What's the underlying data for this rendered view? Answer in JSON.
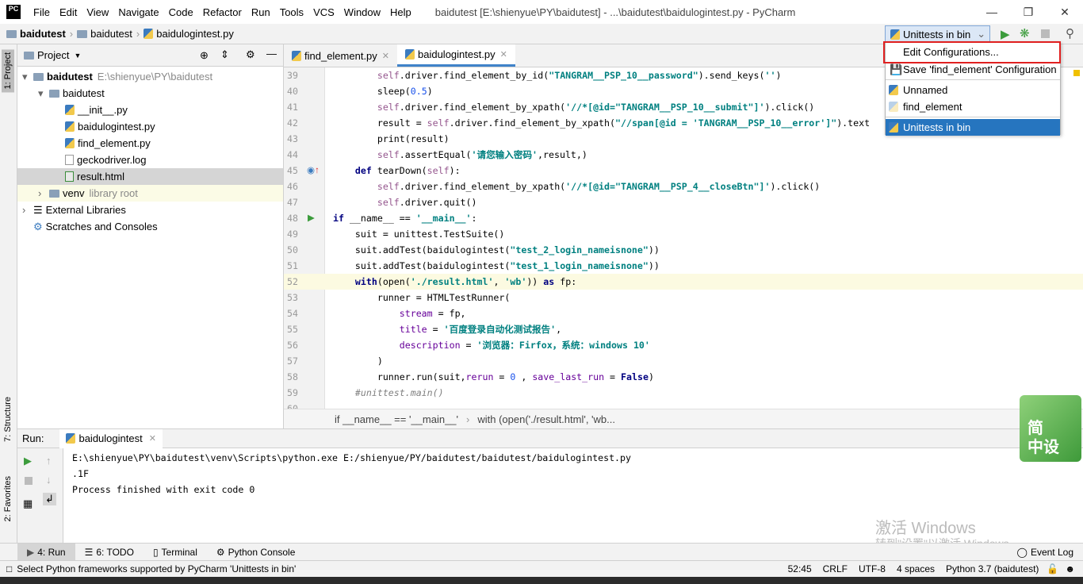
{
  "app": {
    "logo": "PC",
    "title": "baidutest [E:\\shienyue\\PY\\baidutest] - ...\\baidutest\\baidulogintest.py - PyCharm"
  },
  "menu": [
    "File",
    "Edit",
    "View",
    "Navigate",
    "Code",
    "Refactor",
    "Run",
    "Tools",
    "VCS",
    "Window",
    "Help"
  ],
  "breadcrumb": [
    "baidutest",
    "baidutest",
    "baidulogintest.py"
  ],
  "run_config": {
    "selected": "Unittests in bin",
    "menu": {
      "edit": "Edit Configurations...",
      "save": "Save 'find_element' Configuration",
      "items": [
        "Unnamed",
        "find_element"
      ],
      "current": "Unittests in bin"
    }
  },
  "left_stripe": {
    "project": "1: Project",
    "structure": "7: Structure",
    "favorites": "2: Favorites"
  },
  "project": {
    "header": "Project",
    "tree": [
      {
        "label": "baidutest",
        "extra": "E:\\shienyue\\PY\\baidutest",
        "type": "folder",
        "depth": 0,
        "bold": true
      },
      {
        "label": "baidutest",
        "type": "folder",
        "depth": 1
      },
      {
        "label": "__init__.py",
        "type": "py",
        "depth": 2
      },
      {
        "label": "baidulogintest.py",
        "type": "py",
        "depth": 2
      },
      {
        "label": "find_element.py",
        "type": "py",
        "depth": 2
      },
      {
        "label": "geckodriver.log",
        "type": "log",
        "depth": 2
      },
      {
        "label": "result.html",
        "type": "html",
        "depth": 2,
        "selected": true
      },
      {
        "label": "venv",
        "extra": "library root",
        "type": "folder",
        "depth": 1,
        "venv": true
      },
      {
        "label": "External Libraries",
        "type": "lib",
        "depth": 0
      },
      {
        "label": "Scratches and Consoles",
        "type": "scratch",
        "depth": 0
      }
    ]
  },
  "tabs": [
    {
      "label": "find_element.py",
      "active": false
    },
    {
      "label": "baidulogintest.py",
      "active": true
    }
  ],
  "code": [
    {
      "n": "39",
      "i": 8,
      "t": [
        [
          "self",
          "slf"
        ],
        [
          ".driver.find_element_by_id(",
          ""
        ],
        [
          "\"TANGRAM__PSP_10__password\"",
          "str"
        ],
        [
          ").send_keys(",
          ""
        ],
        [
          "''",
          "str"
        ],
        [
          ")",
          ""
        ]
      ]
    },
    {
      "n": "40",
      "i": 8,
      "t": [
        [
          "sleep(",
          ""
        ],
        [
          "0.5",
          "num"
        ],
        [
          ")",
          ""
        ]
      ]
    },
    {
      "n": "41",
      "i": 8,
      "t": [
        [
          "self",
          "slf"
        ],
        [
          ".driver.find_element_by_xpath(",
          ""
        ],
        [
          "'//*[@id=\"TANGRAM__PSP_10__submit\"]'",
          "str"
        ],
        [
          ").click()",
          ""
        ]
      ]
    },
    {
      "n": "42",
      "i": 8,
      "t": [
        [
          "result = ",
          ""
        ],
        [
          "self",
          "slf"
        ],
        [
          ".driver.find_element_by_xpath(",
          ""
        ],
        [
          "\"//span[@id = 'TANGRAM__PSP_10__error']\"",
          "str"
        ],
        [
          ").text",
          ""
        ]
      ]
    },
    {
      "n": "43",
      "i": 8,
      "t": [
        [
          "print(result)",
          ""
        ]
      ]
    },
    {
      "n": "44",
      "i": 8,
      "t": [
        [
          "self",
          "slf"
        ],
        [
          ".assertEqual(",
          ""
        ],
        [
          "'请您输入密码'",
          "str"
        ],
        [
          ",result,)",
          ""
        ]
      ]
    },
    {
      "n": "45",
      "i": 4,
      "t": [
        [
          "def ",
          "kw"
        ],
        [
          "tearDown(",
          ""
        ],
        [
          "self",
          "slf"
        ],
        [
          "):",
          ""
        ]
      ]
    },
    {
      "n": "46",
      "i": 8,
      "t": [
        [
          "self",
          "slf"
        ],
        [
          ".driver.find_element_by_xpath(",
          ""
        ],
        [
          "'//*[@id=\"TANGRAM__PSP_4__closeBtn\"]'",
          "str"
        ],
        [
          ").click()",
          ""
        ]
      ]
    },
    {
      "n": "47",
      "i": 8,
      "t": [
        [
          "self",
          "slf"
        ],
        [
          ".driver.quit()",
          ""
        ]
      ]
    },
    {
      "n": "48",
      "i": 0,
      "t": [
        [
          "if ",
          "kw"
        ],
        [
          "__name__ == ",
          ""
        ],
        [
          "'__main__'",
          "str"
        ],
        [
          ":",
          ""
        ]
      ]
    },
    {
      "n": "49",
      "i": 4,
      "t": [
        [
          "suit = unittest.TestSuite()",
          ""
        ]
      ]
    },
    {
      "n": "50",
      "i": 4,
      "t": [
        [
          "suit.addTest(baidulogintest(",
          ""
        ],
        [
          "\"test_2_login_nameisnone\"",
          "str"
        ],
        [
          "))",
          ""
        ]
      ]
    },
    {
      "n": "51",
      "i": 4,
      "t": [
        [
          "suit.addTest(baidulogintest(",
          ""
        ],
        [
          "\"test_1_login_nameisnone\"",
          "str"
        ],
        [
          "))",
          ""
        ]
      ]
    },
    {
      "n": "52",
      "i": 4,
      "t": [
        [
          "with",
          "kw"
        ],
        [
          "(open(",
          ""
        ],
        [
          "'./result.html'",
          "str"
        ],
        [
          ", ",
          ""
        ],
        [
          "'wb'",
          "str"
        ],
        [
          ")) ",
          ""
        ],
        [
          "as ",
          "kw"
        ],
        [
          "fp:",
          ""
        ]
      ]
    },
    {
      "n": "53",
      "i": 8,
      "t": [
        [
          "runner = HTMLTestRunner(",
          ""
        ]
      ]
    },
    {
      "n": "54",
      "i": 12,
      "t": [
        [
          "stream",
          "par"
        ],
        [
          " = fp,",
          ""
        ]
      ]
    },
    {
      "n": "55",
      "i": 12,
      "t": [
        [
          "title",
          "par"
        ],
        [
          " = ",
          ""
        ],
        [
          "'百度登录自动化测试报告'",
          "str"
        ],
        [
          ",",
          ""
        ]
      ]
    },
    {
      "n": "56",
      "i": 12,
      "t": [
        [
          "description",
          "par"
        ],
        [
          " = ",
          ""
        ],
        [
          "'浏览器：Firfox，系统：windows 10'",
          "str"
        ]
      ]
    },
    {
      "n": "57",
      "i": 8,
      "t": [
        [
          ")",
          ""
        ]
      ]
    },
    {
      "n": "58",
      "i": 8,
      "t": [
        [
          "runner.run(suit,",
          ""
        ],
        [
          "rerun",
          "par"
        ],
        [
          " = ",
          ""
        ],
        [
          "0",
          "num"
        ],
        [
          " , ",
          ""
        ],
        [
          "save_last_run",
          "par"
        ],
        [
          " = ",
          ""
        ],
        [
          "False",
          "kw"
        ],
        [
          ")",
          ""
        ]
      ]
    },
    {
      "n": "59",
      "i": 4,
      "t": [
        [
          "#unittest.main()",
          "cmt"
        ]
      ]
    },
    {
      "n": "60",
      "i": 0,
      "t": []
    }
  ],
  "current_line": "52",
  "editor_breadcrumb": [
    "if __name__ == '__main__'",
    "with (open('./result.html', 'wb..."
  ],
  "run": {
    "label": "Run:",
    "tab": "baidulogintest",
    "output": [
      "E:\\shienyue\\PY\\baidutest\\venv\\Scripts\\python.exe E:/shienyue/PY/baidutest/baidutest/baidulogintest.py",
      ".1F",
      "Process finished with exit code 0"
    ]
  },
  "bottom_tabs": [
    "4: Run",
    "6: TODO",
    "Terminal",
    "Python Console"
  ],
  "event_log": "Event Log",
  "status": {
    "message": "Select Python frameworks supported by PyCharm 'Unittests in bin'",
    "position": "52:45",
    "line_sep": "CRLF",
    "encoding": "UTF-8",
    "indent": "4 spaces",
    "interpreter": "Python 3.7 (baidutest)"
  },
  "watermark": {
    "line1": "激活 Windows",
    "line2": "转到\"设置\"以激活 Windows。"
  },
  "ime": "简\n中设",
  "colors": {
    "accent": "#2675bf",
    "highlight_box": "#e02020",
    "current_line": "#fcfae1"
  }
}
